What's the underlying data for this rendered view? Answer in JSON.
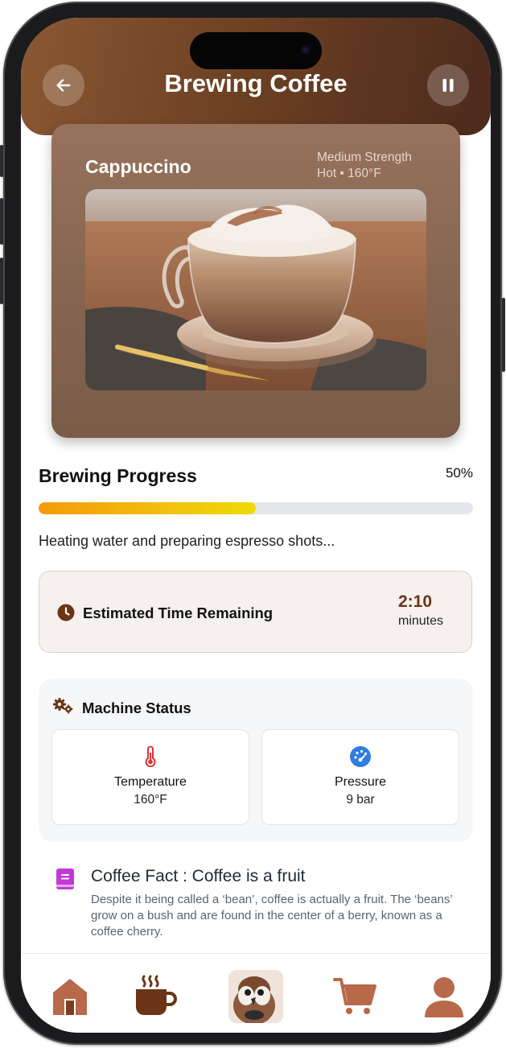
{
  "header": {
    "title": "Brewing Coffee",
    "back_icon": "arrow-left-icon",
    "pause_icon": "pause-icon"
  },
  "drink": {
    "name": "Cappuccino",
    "strength": "Medium Strength",
    "temp_line": "Hot • 160°F",
    "image": "cappuccino-photo"
  },
  "progress": {
    "title": "Brewing Progress",
    "percent_label": "50%",
    "fraction": 0.5,
    "status": "Heating water and preparing espresso shots..."
  },
  "time": {
    "label": "Estimated Time Remaining",
    "value": "2:10",
    "unit": "minutes",
    "icon": "clock-icon"
  },
  "machine": {
    "title": "Machine Status",
    "icon": "gears-icon",
    "stats": [
      {
        "label": "Temperature",
        "value": "160°F",
        "icon": "thermometer-icon"
      },
      {
        "label": "Pressure",
        "value": "9 bar",
        "icon": "gauge-icon"
      }
    ]
  },
  "fact": {
    "title": "Coffee Fact : Coffee is a fruit",
    "body": "Despite it being called a ‘bean’, coffee is actually a fruit. The ‘beans’ grow on a bush and are found in the center of a berry, known as a coffee cherry.",
    "icon": "book-icon"
  },
  "nav": {
    "items": [
      "home-icon",
      "coffee-cup-icon",
      "mascot-avatar",
      "cart-icon",
      "profile-icon"
    ]
  },
  "colors": {
    "header_start": "#8a5732",
    "header_end": "#4c2a1d",
    "card": "#876650",
    "progress_start": "#f59a0b",
    "progress_end": "#eedb08",
    "time_value": "#6b3417",
    "nav_accent": "#b8694a"
  }
}
